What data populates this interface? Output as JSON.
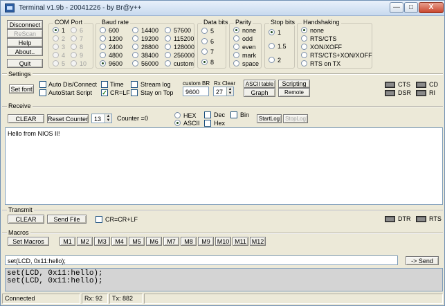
{
  "window": {
    "title": "Terminal v1.9b - 20041226 - by Br@y++",
    "min_glyph": "—",
    "max_glyph": "□",
    "close_glyph": "X"
  },
  "actions": {
    "disconnect": "Disconnect",
    "rescan": "ReScan",
    "help": "Help",
    "about": "About..",
    "quit": "Quit"
  },
  "com_port": {
    "title": "COM Port",
    "options": [
      "1",
      "2",
      "3",
      "4",
      "5",
      "6",
      "7",
      "8",
      "9",
      "10"
    ],
    "selected": "1"
  },
  "baud_rate": {
    "title": "Baud rate",
    "options": [
      "600",
      "1200",
      "2400",
      "4800",
      "9600",
      "14400",
      "19200",
      "28800",
      "38400",
      "56000",
      "57600",
      "115200",
      "128000",
      "256000",
      "custom"
    ],
    "selected": "9600"
  },
  "data_bits": {
    "title": "Data bits",
    "options": [
      "5",
      "6",
      "7",
      "8"
    ],
    "selected": "8"
  },
  "parity": {
    "title": "Parity",
    "options": [
      "none",
      "odd",
      "even",
      "mark",
      "space"
    ],
    "selected": "none"
  },
  "stop_bits": {
    "title": "Stop bits",
    "options": [
      "1",
      "1.5",
      "2"
    ],
    "selected": "1"
  },
  "handshaking": {
    "title": "Handshaking",
    "options": [
      "none",
      "RTS/CTS",
      "XON/XOFF",
      "RTS/CTS+XON/XOFF",
      "RTS on TX"
    ],
    "selected": "none"
  },
  "settings": {
    "title": "Settings",
    "set_font": "Set font",
    "auto_dis_connect": "Auto Dis/Connect",
    "autostart_script": "AutoStart Script",
    "time": "Time",
    "cr_lf": "CR=LF",
    "stream_log": "Stream log",
    "stay_on_top": "Stay on Top",
    "custom_br_label": "custom BR",
    "custom_br_value": "9600",
    "rx_clear_label": "Rx Clear",
    "rx_clear_value": "27",
    "ascii_table": "ASCII table",
    "graph": "Graph",
    "scripting": "Scripting",
    "remote": "Remote",
    "check_glyph": "✓",
    "spin_up": "▲",
    "spin_down": "▼"
  },
  "leds": {
    "cts": "CTS",
    "cd": "CD",
    "dsr": "DSR",
    "ri": "RI",
    "dtr": "DTR",
    "rts": "RTS"
  },
  "receive": {
    "title": "Receive",
    "clear": "CLEAR",
    "reset_counter": "Reset Counter",
    "counter_spin": "13",
    "counter_label": "Counter =",
    "counter_value": "0",
    "hex": "HEX",
    "ascii": "ASCII",
    "dec": "Dec",
    "hex_chk": "Hex",
    "bin": "Bin",
    "start_log": "StartLog",
    "stop_log": "StopLog",
    "content": "Hello from NIOS II!"
  },
  "transmit": {
    "title": "Transmit",
    "clear": "CLEAR",
    "send_file": "Send File",
    "cr_cr_lf": "CR=CR+LF"
  },
  "macros": {
    "title": "Macros",
    "set_macros": "Set Macros",
    "items": [
      "M1",
      "M2",
      "M3",
      "M4",
      "M5",
      "M6",
      "M7",
      "M8",
      "M9",
      "M10",
      "M11",
      "M12"
    ]
  },
  "send": {
    "input_value": "set(LCD, 0x11:hello);",
    "button": "-> Send",
    "log": [
      "set(LCD, 0x11:hello);",
      "set(LCD, 0x11:hello);"
    ]
  },
  "status": {
    "connection": "Connected",
    "rx": "Rx: 92",
    "tx": "Tx: 882"
  }
}
